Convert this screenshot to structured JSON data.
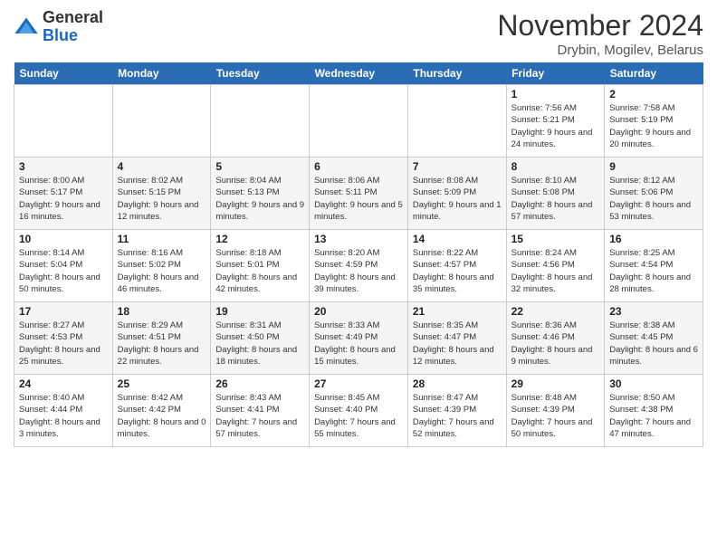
{
  "header": {
    "logo_general": "General",
    "logo_blue": "Blue",
    "month_title": "November 2024",
    "subtitle": "Drybin, Mogilev, Belarus"
  },
  "weekdays": [
    "Sunday",
    "Monday",
    "Tuesday",
    "Wednesday",
    "Thursday",
    "Friday",
    "Saturday"
  ],
  "weeks": [
    [
      {
        "day": "",
        "info": ""
      },
      {
        "day": "",
        "info": ""
      },
      {
        "day": "",
        "info": ""
      },
      {
        "day": "",
        "info": ""
      },
      {
        "day": "",
        "info": ""
      },
      {
        "day": "1",
        "info": "Sunrise: 7:56 AM\nSunset: 5:21 PM\nDaylight: 9 hours and 24 minutes."
      },
      {
        "day": "2",
        "info": "Sunrise: 7:58 AM\nSunset: 5:19 PM\nDaylight: 9 hours and 20 minutes."
      }
    ],
    [
      {
        "day": "3",
        "info": "Sunrise: 8:00 AM\nSunset: 5:17 PM\nDaylight: 9 hours and 16 minutes."
      },
      {
        "day": "4",
        "info": "Sunrise: 8:02 AM\nSunset: 5:15 PM\nDaylight: 9 hours and 12 minutes."
      },
      {
        "day": "5",
        "info": "Sunrise: 8:04 AM\nSunset: 5:13 PM\nDaylight: 9 hours and 9 minutes."
      },
      {
        "day": "6",
        "info": "Sunrise: 8:06 AM\nSunset: 5:11 PM\nDaylight: 9 hours and 5 minutes."
      },
      {
        "day": "7",
        "info": "Sunrise: 8:08 AM\nSunset: 5:09 PM\nDaylight: 9 hours and 1 minute."
      },
      {
        "day": "8",
        "info": "Sunrise: 8:10 AM\nSunset: 5:08 PM\nDaylight: 8 hours and 57 minutes."
      },
      {
        "day": "9",
        "info": "Sunrise: 8:12 AM\nSunset: 5:06 PM\nDaylight: 8 hours and 53 minutes."
      }
    ],
    [
      {
        "day": "10",
        "info": "Sunrise: 8:14 AM\nSunset: 5:04 PM\nDaylight: 8 hours and 50 minutes."
      },
      {
        "day": "11",
        "info": "Sunrise: 8:16 AM\nSunset: 5:02 PM\nDaylight: 8 hours and 46 minutes."
      },
      {
        "day": "12",
        "info": "Sunrise: 8:18 AM\nSunset: 5:01 PM\nDaylight: 8 hours and 42 minutes."
      },
      {
        "day": "13",
        "info": "Sunrise: 8:20 AM\nSunset: 4:59 PM\nDaylight: 8 hours and 39 minutes."
      },
      {
        "day": "14",
        "info": "Sunrise: 8:22 AM\nSunset: 4:57 PM\nDaylight: 8 hours and 35 minutes."
      },
      {
        "day": "15",
        "info": "Sunrise: 8:24 AM\nSunset: 4:56 PM\nDaylight: 8 hours and 32 minutes."
      },
      {
        "day": "16",
        "info": "Sunrise: 8:25 AM\nSunset: 4:54 PM\nDaylight: 8 hours and 28 minutes."
      }
    ],
    [
      {
        "day": "17",
        "info": "Sunrise: 8:27 AM\nSunset: 4:53 PM\nDaylight: 8 hours and 25 minutes."
      },
      {
        "day": "18",
        "info": "Sunrise: 8:29 AM\nSunset: 4:51 PM\nDaylight: 8 hours and 22 minutes."
      },
      {
        "day": "19",
        "info": "Sunrise: 8:31 AM\nSunset: 4:50 PM\nDaylight: 8 hours and 18 minutes."
      },
      {
        "day": "20",
        "info": "Sunrise: 8:33 AM\nSunset: 4:49 PM\nDaylight: 8 hours and 15 minutes."
      },
      {
        "day": "21",
        "info": "Sunrise: 8:35 AM\nSunset: 4:47 PM\nDaylight: 8 hours and 12 minutes."
      },
      {
        "day": "22",
        "info": "Sunrise: 8:36 AM\nSunset: 4:46 PM\nDaylight: 8 hours and 9 minutes."
      },
      {
        "day": "23",
        "info": "Sunrise: 8:38 AM\nSunset: 4:45 PM\nDaylight: 8 hours and 6 minutes."
      }
    ],
    [
      {
        "day": "24",
        "info": "Sunrise: 8:40 AM\nSunset: 4:44 PM\nDaylight: 8 hours and 3 minutes."
      },
      {
        "day": "25",
        "info": "Sunrise: 8:42 AM\nSunset: 4:42 PM\nDaylight: 8 hours and 0 minutes."
      },
      {
        "day": "26",
        "info": "Sunrise: 8:43 AM\nSunset: 4:41 PM\nDaylight: 7 hours and 57 minutes."
      },
      {
        "day": "27",
        "info": "Sunrise: 8:45 AM\nSunset: 4:40 PM\nDaylight: 7 hours and 55 minutes."
      },
      {
        "day": "28",
        "info": "Sunrise: 8:47 AM\nSunset: 4:39 PM\nDaylight: 7 hours and 52 minutes."
      },
      {
        "day": "29",
        "info": "Sunrise: 8:48 AM\nSunset: 4:39 PM\nDaylight: 7 hours and 50 minutes."
      },
      {
        "day": "30",
        "info": "Sunrise: 8:50 AM\nSunset: 4:38 PM\nDaylight: 7 hours and 47 minutes."
      }
    ]
  ]
}
